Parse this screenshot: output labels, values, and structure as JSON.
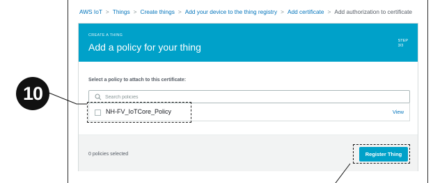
{
  "breadcrumb": [
    {
      "label": "AWS IoT"
    },
    {
      "label": "Things"
    },
    {
      "label": "Create things"
    },
    {
      "label": "Add your device to the thing registry"
    },
    {
      "label": "Add certificate"
    },
    {
      "label": "Add authorization to certificate"
    }
  ],
  "breadcrumb_separator": ">",
  "hero": {
    "small_label": "CREATE A THING",
    "title": "Add a policy for your thing",
    "step_label": "STEP",
    "step_value": "3/3",
    "color": "#00a1c9"
  },
  "policy_section": {
    "label": "Select a policy to attach to this certificate:",
    "search_placeholder": "Search policies",
    "policies": [
      {
        "name": "NH-FV_IoTCore_Policy",
        "view_label": "View",
        "checked": false
      }
    ]
  },
  "footer": {
    "selected_count": "0 policies selected",
    "register_button": "Register Thing"
  },
  "annotation": {
    "badge_number": "10"
  },
  "colors": {
    "accent": "#00a1c9",
    "link": "#0073bb"
  }
}
